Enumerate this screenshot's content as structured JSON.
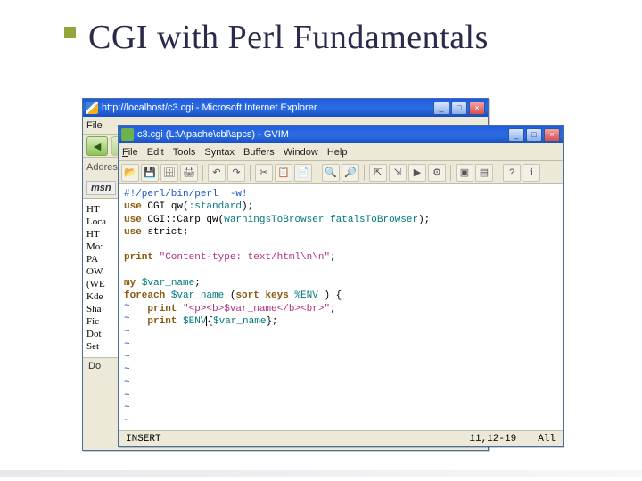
{
  "slide": {
    "title": "CGI with Perl Fundamentals"
  },
  "browser": {
    "title": "http://localhost/c3.cgi - Microsoft Internet Explorer",
    "menu": [
      "File"
    ],
    "address_label": "Address",
    "msn": "msn",
    "body_lines": [
      "HT",
      "Loca",
      "",
      "HT",
      "Mo:",
      "",
      "PA",
      "OW",
      "(WE",
      "Kde",
      "Sha",
      "Fic",
      "Dot",
      "Set"
    ],
    "status_left": "Do",
    "win_controls": {
      "min": "_",
      "max": "□",
      "close": "×"
    }
  },
  "editor": {
    "title": "c3.cgi (L:\\Apache\\cbl\\apcs) - GVIM",
    "menu": [
      "File",
      "Edit",
      "Tools",
      "Syntax",
      "Buffers",
      "Window",
      "Help"
    ],
    "status": {
      "mode": "INSERT",
      "pos": "11,12-19",
      "pct": "All"
    },
    "win_controls": {
      "min": "_",
      "max": "□",
      "close": "×"
    },
    "code": {
      "l1_a": "#!/perl/bin/perl",
      "l1_b": "-w!",
      "l2_a": "use ",
      "l2_b": "CGI",
      "l2_c": " qw(",
      "l2_d": ":standard",
      "l2_e": ");",
      "l3_a": "use ",
      "l3_b": "CGI::Carp",
      "l3_c": " qw(",
      "l3_d": "warningsToBrowser fatalsToBrowser",
      "l3_e": ");",
      "l4_a": "use ",
      "l4_b": "strict",
      "l4_c": ";",
      "l6_a": "print ",
      "l6_b": "\"Content-type: text/html\\n\\n\"",
      "l6_c": ";",
      "l8_a": "my ",
      "l8_b": "$var_name",
      "l8_c": ";",
      "l9_a": "foreach ",
      "l9_b": "$var_name",
      "l9_c": " (",
      "l9_d": "sort keys ",
      "l9_e": "%ENV",
      "l9_f": " ) {",
      "l10_a": "    print ",
      "l10_b": "\"<p><b>$var_name</b><br>\"",
      "l10_c": ";",
      "l11_a": "    print ",
      "l11_b": "$ENV",
      "l11_cursor": "|",
      "l11_c": "{",
      "l11_d": "$var_name",
      "l11_e": "};"
    },
    "toolbar_icons": [
      "open",
      "save",
      "save-all",
      "print",
      "sep",
      "undo",
      "redo",
      "sep",
      "cut",
      "copy",
      "paste",
      "sep",
      "find",
      "find-next",
      "sep",
      "load-sess",
      "save-sess",
      "run",
      "make",
      "sep",
      "tags-jump",
      "tags-back",
      "sep",
      "help",
      "find-help"
    ]
  }
}
